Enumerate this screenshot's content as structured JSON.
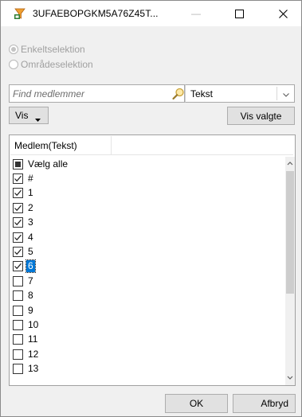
{
  "window": {
    "title": "3UFAEBOPGKM5A76Z45T...",
    "icon": "excel-filter-icon",
    "minimize_glyph": "—",
    "maximize_glyph": "☐",
    "close_glyph": "✕"
  },
  "selection_mode": {
    "options": [
      {
        "label": "Enkeltselektion",
        "checked": true,
        "enabled": false
      },
      {
        "label": "Områdeselektion",
        "checked": false,
        "enabled": false
      }
    ]
  },
  "search": {
    "placeholder": "Find medlemmer",
    "value": "",
    "icon": "search-icon"
  },
  "type_select": {
    "value": "Tekst"
  },
  "toolbar": {
    "vis_label": "Vis",
    "vis_valgte_label": "Vis valgte"
  },
  "list": {
    "column_header": "Medlem(Tekst)",
    "items": [
      {
        "label": "Vælg alle",
        "state": "indeterminate"
      },
      {
        "label": "#",
        "state": "checked"
      },
      {
        "label": "1",
        "state": "checked"
      },
      {
        "label": "2",
        "state": "checked"
      },
      {
        "label": "3",
        "state": "checked"
      },
      {
        "label": "4",
        "state": "checked"
      },
      {
        "label": "5",
        "state": "checked"
      },
      {
        "label": "6",
        "state": "checked",
        "selected": true
      },
      {
        "label": "7",
        "state": "unchecked"
      },
      {
        "label": "8",
        "state": "unchecked"
      },
      {
        "label": "9",
        "state": "unchecked"
      },
      {
        "label": "10",
        "state": "unchecked"
      },
      {
        "label": "11",
        "state": "unchecked"
      },
      {
        "label": "12",
        "state": "unchecked"
      },
      {
        "label": "13",
        "state": "unchecked"
      }
    ],
    "scroll_position": 0
  },
  "footer": {
    "ok_label": "OK",
    "cancel_label": "Afbryd"
  },
  "colors": {
    "selection": "#0078d7",
    "button_face": "#e1e1e1",
    "dialog_bg": "#f0f0f0"
  }
}
